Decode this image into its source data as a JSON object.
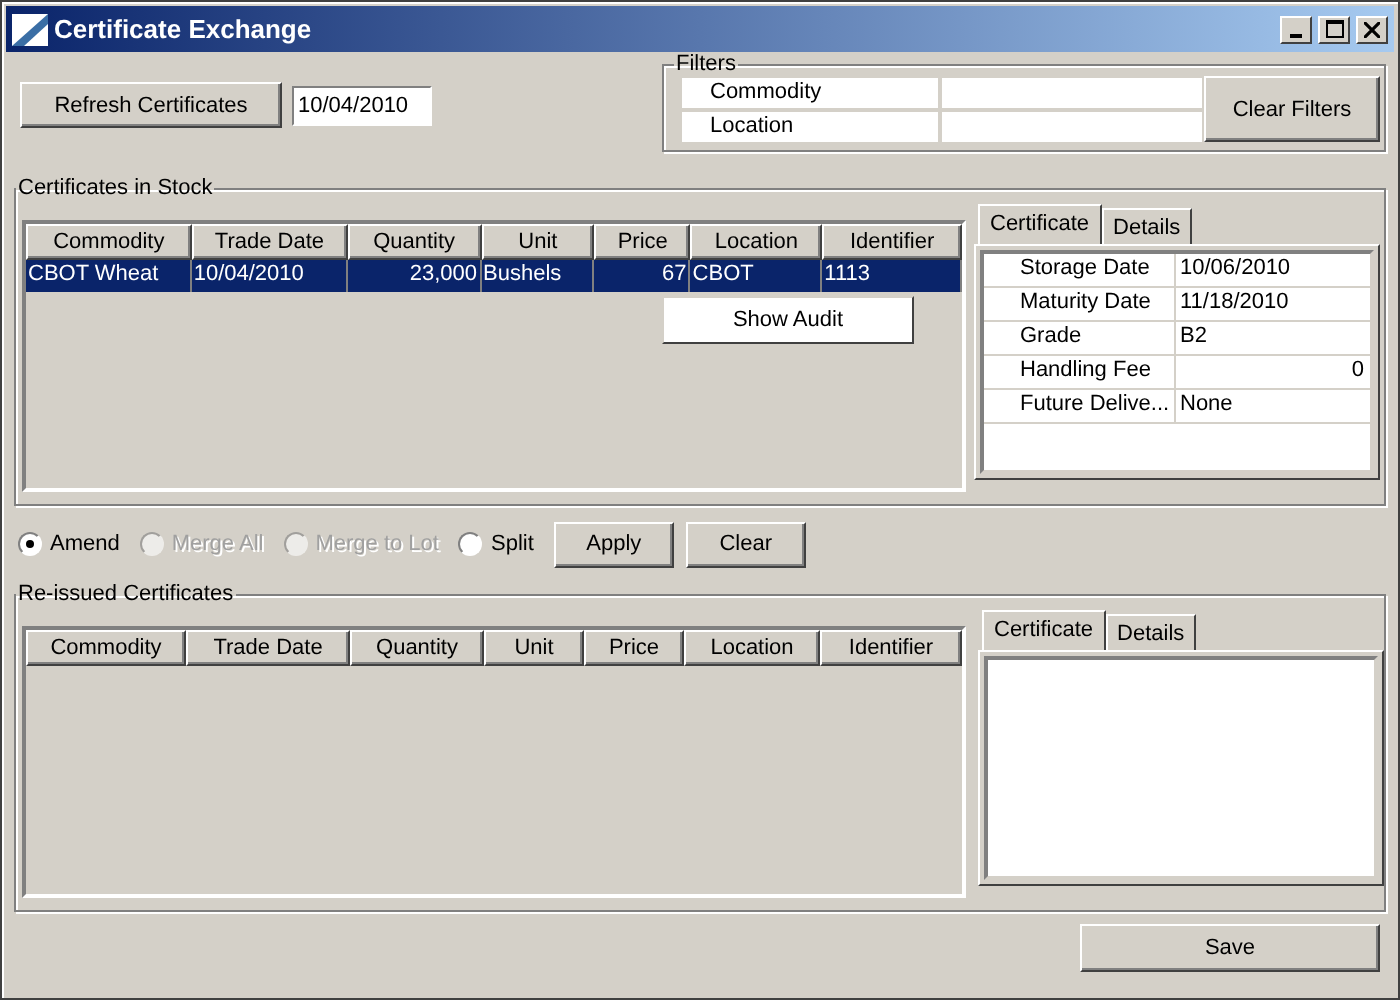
{
  "window": {
    "title": "Certificate Exchange"
  },
  "refresh_button": "Refresh Certificates",
  "date": "10/04/2010",
  "filters": {
    "title": "Filters",
    "rows": [
      {
        "label": "Commodity"
      },
      {
        "label": "Location"
      }
    ],
    "clear_button": "Clear Filters"
  },
  "stock": {
    "title": "Certificates in Stock",
    "columns": [
      {
        "label": "Commodity"
      },
      {
        "label": "Trade Date"
      },
      {
        "label": "Quantity"
      },
      {
        "label": "Unit"
      },
      {
        "label": "Price"
      },
      {
        "label": "Location"
      },
      {
        "label": "Identifier"
      }
    ],
    "rows": [
      {
        "selected": true,
        "cells": [
          "CBOT Wheat",
          "10/04/2010",
          "23,000",
          "Bushels",
          "67",
          "CBOT",
          "1113"
        ]
      }
    ],
    "context_menu": [
      "Show Audit"
    ],
    "detail_tabs": [
      {
        "label": "Certificate",
        "selected": true
      },
      {
        "label": "Details",
        "selected": false
      }
    ],
    "properties": [
      {
        "name": "Storage Date",
        "value": "10/06/2010"
      },
      {
        "name": "Maturity Date",
        "value": "11/18/2010"
      },
      {
        "name": "Grade",
        "value": "B2"
      },
      {
        "name": "Handling Fee",
        "value": "0"
      },
      {
        "name": "Future Delive...",
        "value": "None"
      }
    ]
  },
  "actions": {
    "options": [
      {
        "label": "Amend",
        "selected": true,
        "disabled": false
      },
      {
        "label": "Merge All",
        "selected": false,
        "disabled": true
      },
      {
        "label": "Merge to Lot",
        "selected": false,
        "disabled": true
      },
      {
        "label": "Split",
        "selected": false,
        "disabled": false
      }
    ],
    "buttons": [
      "Apply",
      "Clear"
    ]
  },
  "reissued": {
    "title": "Re-issued Certificates",
    "columns": [
      {
        "label": "Commodity"
      },
      {
        "label": "Trade Date"
      },
      {
        "label": "Quantity"
      },
      {
        "label": "Unit"
      },
      {
        "label": "Price"
      },
      {
        "label": "Location"
      },
      {
        "label": "Identifier"
      }
    ],
    "detail_tabs": [
      {
        "label": "Certificate",
        "selected": true
      },
      {
        "label": "Details",
        "selected": false
      }
    ]
  },
  "save_button": "Save"
}
